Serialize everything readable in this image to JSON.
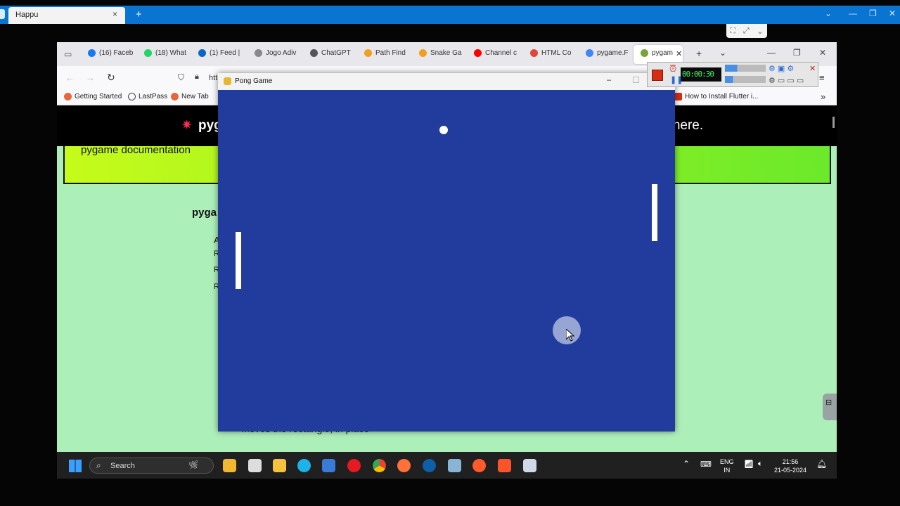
{
  "outer_app": {
    "tab_title": "Happu",
    "tab_close": "×",
    "new_tab": "+"
  },
  "browser": {
    "tabs": [
      {
        "label": "(16) Faceb",
        "icon": "facebook-icon",
        "color": "#1877f2"
      },
      {
        "label": "(18) What",
        "icon": "whatsapp-icon",
        "color": "#25d366"
      },
      {
        "label": "(1) Feed |",
        "icon": "linkedin-icon",
        "color": "#0a66c2"
      },
      {
        "label": "Jogo Adiv",
        "icon": "globe-icon",
        "color": "#888888"
      },
      {
        "label": "ChatGPT",
        "icon": "openai-icon",
        "color": "#555555"
      },
      {
        "label": "Path Find",
        "icon": "codepen-icon",
        "color": "#f0a020"
      },
      {
        "label": "Snake Ga",
        "icon": "codepen-icon",
        "color": "#f0a020"
      },
      {
        "label": "Channel c",
        "icon": "youtube-icon",
        "color": "#ff0000"
      },
      {
        "label": "HTML Co",
        "icon": "opera-icon",
        "color": "#e0453a"
      },
      {
        "label": "pygame.F",
        "icon": "google-icon",
        "color": "#4285f4"
      },
      {
        "label": "pygam",
        "icon": "pygame-icon",
        "color": "#7aa33a"
      }
    ],
    "url_partial": "htt",
    "bookmarks": [
      {
        "label": "Getting Started",
        "icon": "firefox-icon"
      },
      {
        "label": "LastPass",
        "icon": "globe-icon"
      },
      {
        "label": "New Tab",
        "icon": "firefox-icon"
      },
      {
        "label": "How to Install Flutter i...",
        "icon": "tutorial-icon"
      }
    ]
  },
  "page": {
    "banner_left": "pyg",
    "banner_right": "e here.",
    "doc_title": "pygame documentation",
    "heading_partial": "pyga",
    "bottom_text": "moves the rectangle, in place"
  },
  "pong": {
    "window_title": "Pong Game",
    "minimize": "–"
  },
  "recorder": {
    "time_display": "00:00:30"
  },
  "taskbar": {
    "search_placeholder": "Search",
    "lang_line1": "ENG",
    "lang_line2": "IN",
    "time": "21:56",
    "date": "21-05-2024"
  }
}
